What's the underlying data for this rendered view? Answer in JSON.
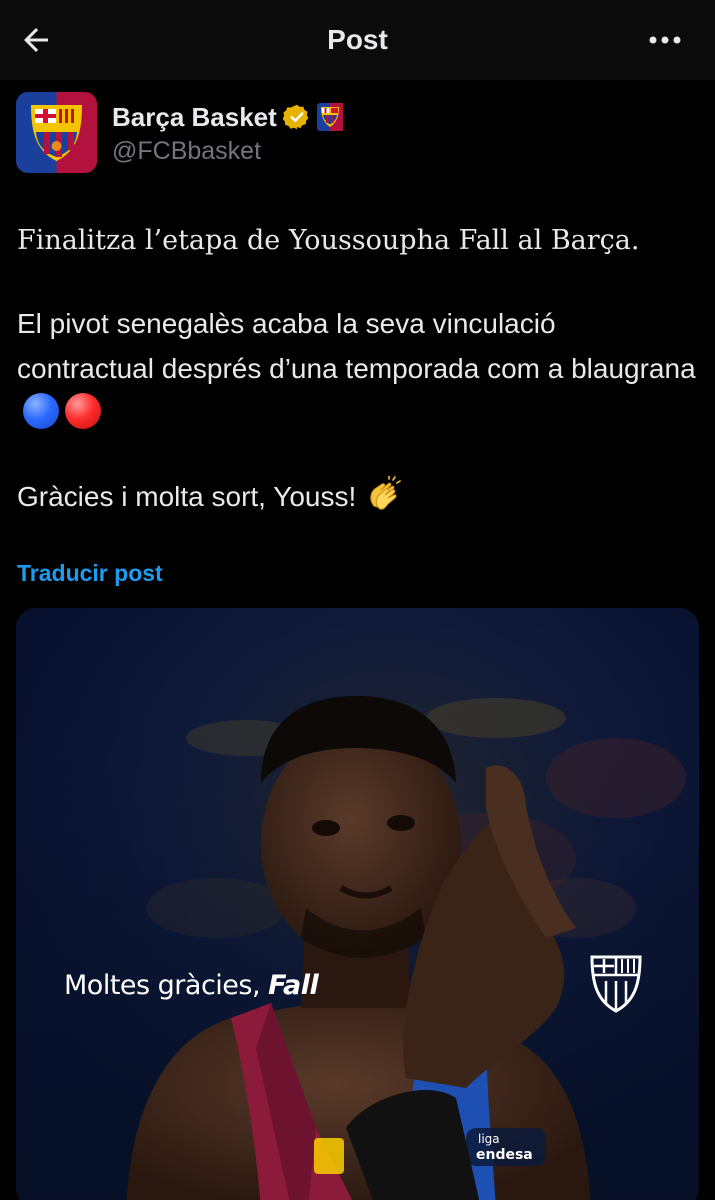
{
  "header": {
    "title": "Post",
    "back_icon": "arrow-left-icon",
    "more_icon": "more-horizontal-icon"
  },
  "author": {
    "name": "Barça Basket",
    "handle": "@FCBbasket",
    "verified_color": "#e8b200",
    "avatar_colors": [
      "#1b3f9c",
      "#b3123f"
    ]
  },
  "post": {
    "line1": "Finalitza l’etapa de Youssoupha Fall al Barça.",
    "line2": "El pivot senegalès acaba la seva vinculació contractual després d’una temporada com a blaugrana",
    "line3": "Gràcies i molta sort, Youss!",
    "emojis": [
      "blue-circle",
      "red-circle",
      "clapping-hands"
    ]
  },
  "translate_label": "Traducir post",
  "media": {
    "caption_prefix": "Moltes gràcies, ",
    "caption_name": "Fall",
    "jersey_text": "liga endesa"
  },
  "colors": {
    "background": "#000000",
    "text": "#e7e9ea",
    "muted": "#71767b",
    "link": "#1d9bf0"
  }
}
